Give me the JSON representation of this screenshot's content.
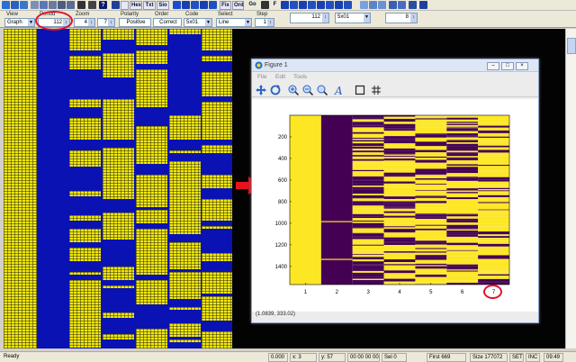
{
  "toolbar": {
    "text_buttons": [
      "Hex",
      "Txt",
      "Sio",
      "Fix",
      "Ord",
      "Go",
      "F"
    ],
    "page_value": "8"
  },
  "options": {
    "view_label": "View",
    "view_value": "Graph",
    "period_label": "Period",
    "period_value": "112",
    "zoom_label": "Zoom",
    "zoom_a": "4",
    "zoom_b": "7",
    "polarity_label": "Polarity",
    "polarity_value": "Positive",
    "order_label": "Order",
    "order_value": "Correct",
    "code_label": "Code",
    "code_value": "5x01",
    "select_label": "Select",
    "select_value": "Line",
    "step_label": "Step",
    "step_value": "1",
    "period_right_value": "112",
    "code_right_value": "5x01"
  },
  "figure": {
    "title": "Figure 1",
    "menus": [
      "File",
      "Edit",
      "Tools"
    ],
    "coordinates": "(1.0839, 333.02)",
    "window_buttons": [
      "–",
      "□",
      "×"
    ]
  },
  "chart_data": {
    "type": "heatmap",
    "title": "",
    "xlabel": "",
    "ylabel": "",
    "x_ticks": [
      "1",
      "2",
      "3",
      "4",
      "5",
      "6",
      "7"
    ],
    "y_ticks": [
      "200",
      "400",
      "600",
      "800",
      "1000",
      "1200",
      "1400"
    ],
    "ylim": [
      0,
      1568
    ],
    "colormap": {
      "low": "#440154",
      "high": "#fde725"
    },
    "columns": [
      {
        "x": 1,
        "pattern": "all-high"
      },
      {
        "x": 2,
        "pattern": "all-low",
        "high_rows": [
          985,
          1335
        ]
      },
      {
        "x": 3,
        "pattern": "mixed"
      },
      {
        "x": 4,
        "pattern": "mixed"
      },
      {
        "x": 5,
        "pattern": "mixed"
      },
      {
        "x": 6,
        "pattern": "mixed"
      },
      {
        "x": 7,
        "pattern": "mixed-mostly-high"
      }
    ]
  },
  "status": {
    "ready": "Ready",
    "val": "0.000",
    "x": "x: 3",
    "y": "y: 57",
    "time": "00 00 00 00",
    "sel": "Sel 0",
    "first": "First 669",
    "size": "Size 177072",
    "set": "SET",
    "inc": "INC",
    "clock": "09:49"
  },
  "colors": {
    "stripe_yellow": "#f1e80a",
    "stripe_blue": "#0b12b3",
    "highlight_red": "#e0102a"
  }
}
